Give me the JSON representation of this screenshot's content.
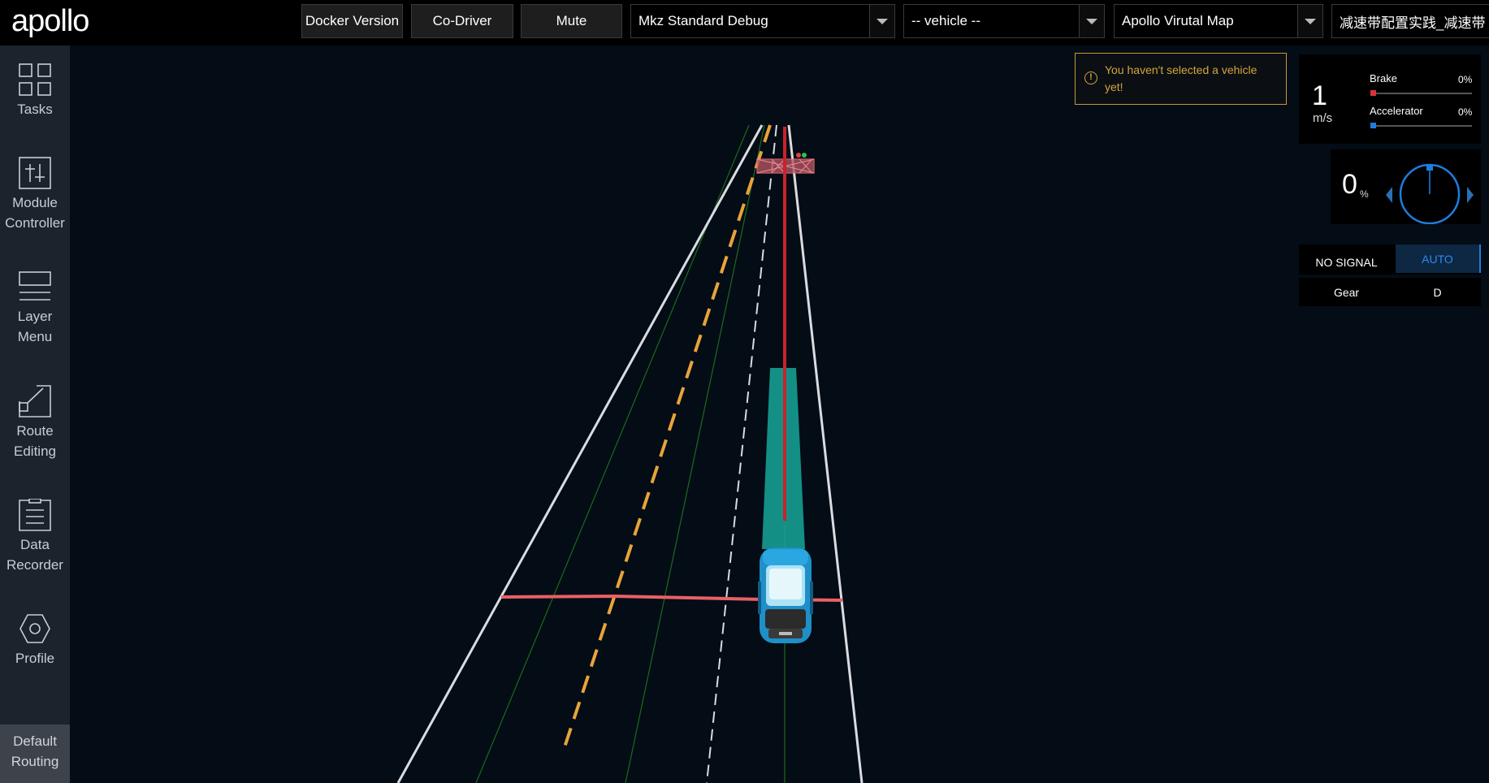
{
  "header": {
    "logo_text": "apollo",
    "buttons": {
      "docker_version": "Docker Version",
      "co_driver": "Co-Driver",
      "mute": "Mute"
    },
    "selects": {
      "mode": "Mkz Standard Debug",
      "vehicle": "-- vehicle --",
      "map": "Apollo Virutal Map",
      "scenario": "减速带配置实践_减速带"
    }
  },
  "sidebar": {
    "items": [
      {
        "label": "Tasks",
        "icon": "grid-icon"
      },
      {
        "label": "Module Controller",
        "icon": "sliders-icon"
      },
      {
        "label": "Layer Menu",
        "icon": "layers-icon"
      },
      {
        "label": "Route Editing",
        "icon": "route-icon"
      },
      {
        "label": "Data Recorder",
        "icon": "clipboard-icon"
      },
      {
        "label": "Profile",
        "icon": "hexagon-icon"
      }
    ],
    "bottom": {
      "label": "Default Routing"
    }
  },
  "notice": {
    "text": "You haven't selected a vehicle yet!"
  },
  "dashboard": {
    "speed": {
      "value": "1",
      "unit": "m/s"
    },
    "brake": {
      "label": "Brake",
      "value": "0%",
      "fill": 0,
      "color": "#d9343d"
    },
    "accelerator": {
      "label": "Accelerator",
      "value": "0%",
      "fill": 0,
      "color": "#1e7dde"
    },
    "steering": {
      "value": "0",
      "unit": "%",
      "angle_percent": 0
    },
    "signal": {
      "label": "NO SIGNAL",
      "mode": "AUTO"
    },
    "gear": {
      "label": "Gear",
      "value": "D"
    }
  },
  "colors": {
    "background": "#040c16",
    "lane_white": "#d9dce0",
    "lane_yellow": "#e8a33a",
    "stop_line": "#e86166",
    "path_teal": "#18a79a",
    "accent_blue": "#1e7dde"
  }
}
